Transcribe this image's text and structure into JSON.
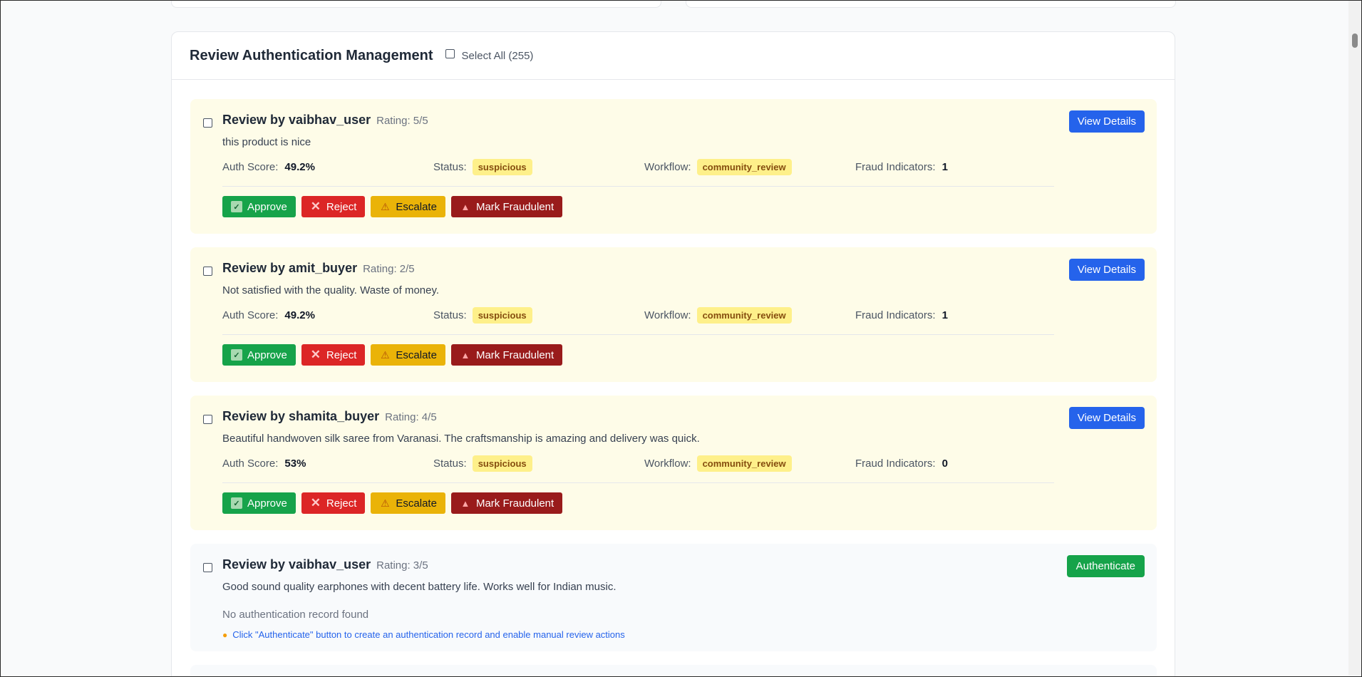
{
  "panel": {
    "title": "Review Authentication Management",
    "select_all_label": "Select All (255)"
  },
  "labels": {
    "auth_score": "Auth Score:",
    "status": "Status:",
    "workflow": "Workflow:",
    "fraud_indicators": "Fraud Indicators:",
    "approve": "Approve",
    "reject": "Reject",
    "escalate": "Escalate",
    "mark_fraudulent": "Mark Fraudulent",
    "view_details": "View Details",
    "authenticate": "Authenticate"
  },
  "icons": {
    "approve": "check-box-icon",
    "reject": "cross-mark-icon",
    "escalate": "warning-icon",
    "mark_fraudulent": "siren-icon",
    "hint": "light-bulb-icon"
  },
  "colors": {
    "approve": "#16a34a",
    "reject": "#dc2626",
    "escalate": "#eab308",
    "fraud": "#991b1b",
    "primary": "#2563eb",
    "flagged_bg": "#fefce8",
    "status_badge": "#fef08a"
  },
  "reviews": [
    {
      "title": "Review by vaibhav_user",
      "rating": "Rating: 5/5",
      "text": "this product is nice",
      "auth_score": "49.2%",
      "status": "suspicious",
      "workflow": "community_review",
      "fraud_indicators": "1"
    },
    {
      "title": "Review by amit_buyer",
      "rating": "Rating: 2/5",
      "text": "Not satisfied with the quality. Waste of money.",
      "auth_score": "49.2%",
      "status": "suspicious",
      "workflow": "community_review",
      "fraud_indicators": "1"
    },
    {
      "title": "Review by shamita_buyer",
      "rating": "Rating: 4/5",
      "text": "Beautiful handwoven silk saree from Varanasi. The craftsmanship is amazing and delivery was quick.",
      "auth_score": "53%",
      "status": "suspicious",
      "workflow": "community_review",
      "fraud_indicators": "0"
    },
    {
      "title": "Review by vaibhav_user",
      "rating": "Rating: 3/5",
      "text": "Good sound quality earphones with decent battery life. Works well for Indian music.",
      "no_record": "No authentication record found",
      "hint": "Click \"Authenticate\" button to create an authentication record and enable manual review actions"
    }
  ]
}
